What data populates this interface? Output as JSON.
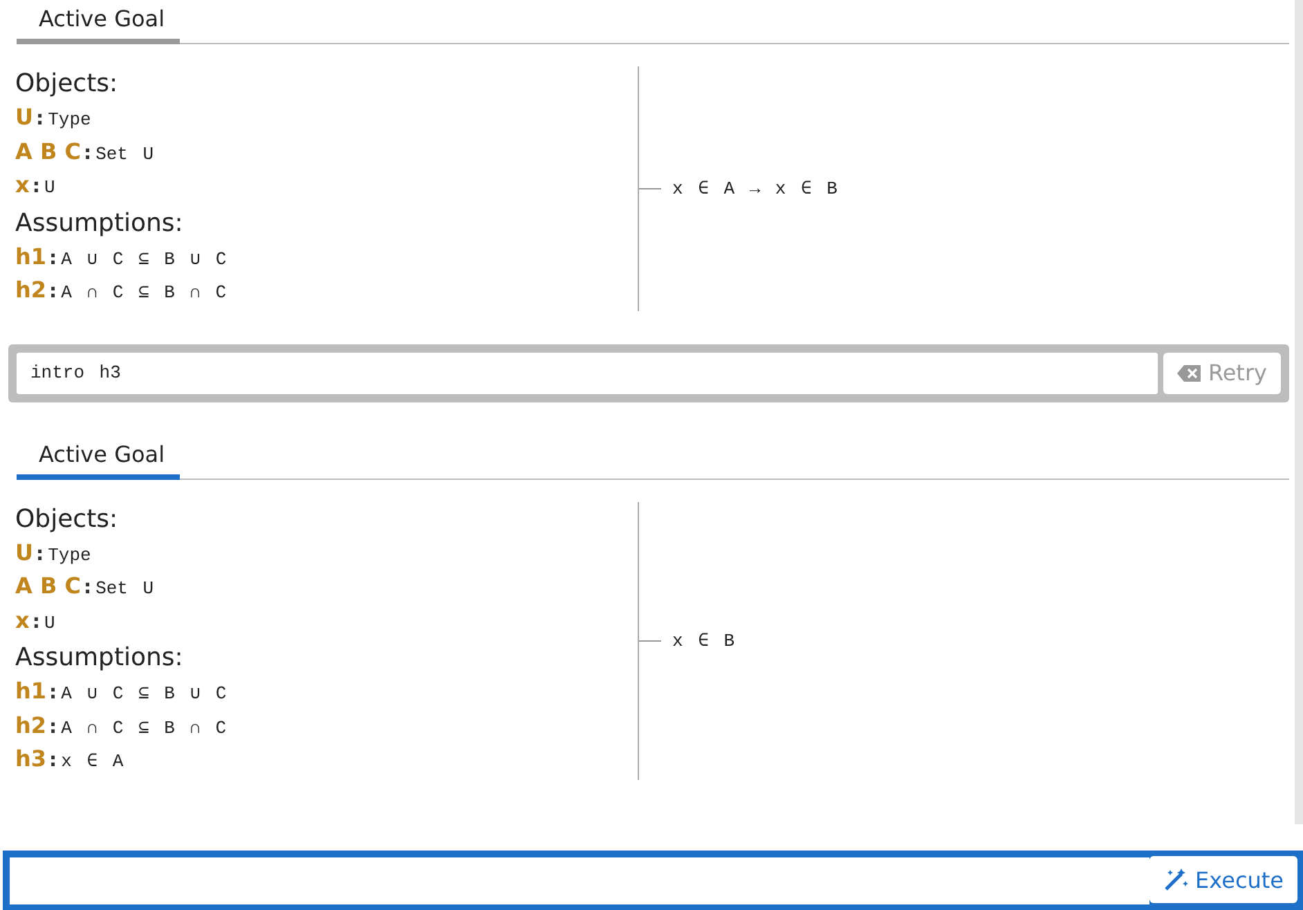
{
  "steps": [
    {
      "tab": {
        "label": "Active Goal",
        "selected": false
      },
      "objects_heading": "Objects:",
      "objects": [
        {
          "names": "U",
          "separator": ":",
          "type": "Type"
        },
        {
          "names": "A B C",
          "separator": ":",
          "type": "Set U"
        },
        {
          "names": "x",
          "separator": ":",
          "type": "U"
        }
      ],
      "assumptions_heading": "Assumptions:",
      "assumptions": [
        {
          "name": "h1",
          "separator": ":",
          "prop": "A ∪ C ⊆ B ∪ C"
        },
        {
          "name": "h2",
          "separator": ":",
          "prop": "A ∩ C ⊆ B ∩ C"
        }
      ],
      "goal": "x ∈ A → x ∈ B",
      "command": {
        "value": "intro h3",
        "button": "Retry"
      }
    },
    {
      "tab": {
        "label": "Active Goal",
        "selected": true
      },
      "objects_heading": "Objects:",
      "objects": [
        {
          "names": "U",
          "separator": ":",
          "type": "Type"
        },
        {
          "names": "A B C",
          "separator": ":",
          "type": "Set U"
        },
        {
          "names": "x",
          "separator": ":",
          "type": "U"
        }
      ],
      "assumptions_heading": "Assumptions:",
      "assumptions": [
        {
          "name": "h1",
          "separator": ":",
          "prop": "A ∪ C ⊆ B ∪ C"
        },
        {
          "name": "h2",
          "separator": ":",
          "prop": "A ∩ C ⊆ B ∩ C"
        },
        {
          "name": "h3",
          "separator": ":",
          "prop": "x ∈ A"
        }
      ],
      "goal": "x ∈ B"
    }
  ],
  "input": {
    "button": "Execute"
  }
}
